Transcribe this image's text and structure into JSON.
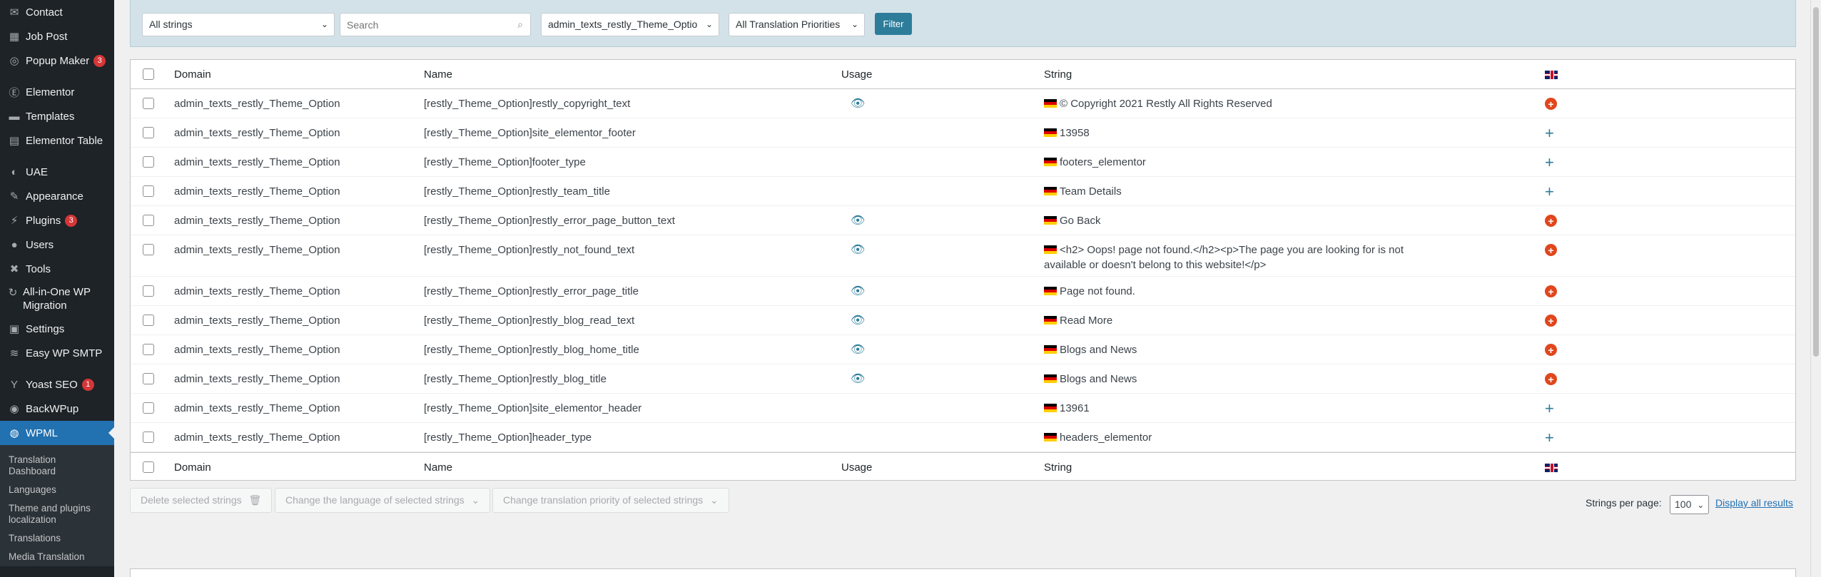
{
  "sidebar": {
    "items": [
      {
        "label": "Contact",
        "icon": "envelope-icon",
        "glyph": "✉"
      },
      {
        "label": "Job Post",
        "icon": "grid-icon",
        "glyph": "▦"
      },
      {
        "label": "Popup Maker",
        "icon": "popup-icon",
        "glyph": "◎",
        "badge": "3"
      },
      {
        "label": "Elementor",
        "icon": "elementor-icon",
        "glyph": "Ⓔ"
      },
      {
        "label": "Templates",
        "icon": "folder-icon",
        "glyph": "▬"
      },
      {
        "label": "Elementor Table",
        "icon": "table-icon",
        "glyph": "▤"
      },
      {
        "label": "UAE",
        "icon": "uae-icon",
        "glyph": "◐"
      },
      {
        "label": "Appearance",
        "icon": "brush-icon",
        "glyph": "✎"
      },
      {
        "label": "Plugins",
        "icon": "plugin-icon",
        "glyph": "⚡",
        "badge": "3"
      },
      {
        "label": "Users",
        "icon": "user-icon",
        "glyph": "●"
      },
      {
        "label": "Tools",
        "icon": "wrench-icon",
        "glyph": "✖"
      },
      {
        "label": "All-in-One WP Migration",
        "icon": "migration-icon",
        "glyph": "↻"
      },
      {
        "label": "Settings",
        "icon": "settings-icon",
        "glyph": "▣"
      },
      {
        "label": "Easy WP SMTP",
        "icon": "smtp-icon",
        "glyph": "≋"
      },
      {
        "label": "Yoast SEO",
        "icon": "yoast-icon",
        "glyph": "Y",
        "badge": "1"
      },
      {
        "label": "BackWPup",
        "icon": "backwpup-icon",
        "glyph": "◉"
      },
      {
        "label": "WPML",
        "icon": "wpml-icon",
        "glyph": "◍",
        "active": true
      }
    ],
    "submenu": [
      "Translation Dashboard",
      "Languages",
      "Theme and plugins localization",
      "Translations",
      "Media Translation"
    ]
  },
  "filters": {
    "strings_select": "All strings",
    "search_placeholder": "Search",
    "domain_select": "admin_texts_restly_Theme_Optio",
    "priority_select": "All Translation Priorities",
    "filter_button": "Filter"
  },
  "table": {
    "headers": {
      "domain": "Domain",
      "name": "Name",
      "usage": "Usage",
      "string": "String"
    },
    "rows": [
      {
        "domain": "admin_texts_restly_Theme_Option",
        "name": "[restly_Theme_Option]restly_copyright_text",
        "usage": true,
        "string": "© Copyright 2021 Restly All Rights Reserved",
        "action": "add"
      },
      {
        "domain": "admin_texts_restly_Theme_Option",
        "name": "[restly_Theme_Option]site_elementor_footer",
        "usage": false,
        "string": "13958",
        "action": "plus"
      },
      {
        "domain": "admin_texts_restly_Theme_Option",
        "name": "[restly_Theme_Option]footer_type",
        "usage": false,
        "string": "footers_elementor",
        "action": "plus"
      },
      {
        "domain": "admin_texts_restly_Theme_Option",
        "name": "[restly_Theme_Option]restly_team_title",
        "usage": false,
        "string": "Team Details",
        "action": "plus"
      },
      {
        "domain": "admin_texts_restly_Theme_Option",
        "name": "[restly_Theme_Option]restly_error_page_button_text",
        "usage": true,
        "string": "Go Back",
        "action": "add"
      },
      {
        "domain": "admin_texts_restly_Theme_Option",
        "name": "[restly_Theme_Option]restly_not_found_text",
        "usage": true,
        "string": "<h2> Oops! page not found.</h2><p>The page you are looking for is not available or doesn't belong to this website!</p>",
        "action": "add"
      },
      {
        "domain": "admin_texts_restly_Theme_Option",
        "name": "[restly_Theme_Option]restly_error_page_title",
        "usage": true,
        "string": "Page not found.",
        "action": "add"
      },
      {
        "domain": "admin_texts_restly_Theme_Option",
        "name": "[restly_Theme_Option]restly_blog_read_text",
        "usage": true,
        "string": "Read More",
        "action": "add"
      },
      {
        "domain": "admin_texts_restly_Theme_Option",
        "name": "[restly_Theme_Option]restly_blog_home_title",
        "usage": true,
        "string": "Blogs and News",
        "action": "add"
      },
      {
        "domain": "admin_texts_restly_Theme_Option",
        "name": "[restly_Theme_Option]restly_blog_title",
        "usage": true,
        "string": "Blogs and News",
        "action": "add"
      },
      {
        "domain": "admin_texts_restly_Theme_Option",
        "name": "[restly_Theme_Option]site_elementor_header",
        "usage": false,
        "string": "13961",
        "action": "plus"
      },
      {
        "domain": "admin_texts_restly_Theme_Option",
        "name": "[restly_Theme_Option]header_type",
        "usage": false,
        "string": "headers_elementor",
        "action": "plus"
      }
    ]
  },
  "bulk": {
    "delete": "Delete selected strings",
    "change_language": "Change the language of selected strings",
    "change_priority": "Change translation priority of selected strings"
  },
  "pagination": {
    "per_page_label": "Strings per page:",
    "per_page_value": "100",
    "display_all": "Display all results"
  }
}
